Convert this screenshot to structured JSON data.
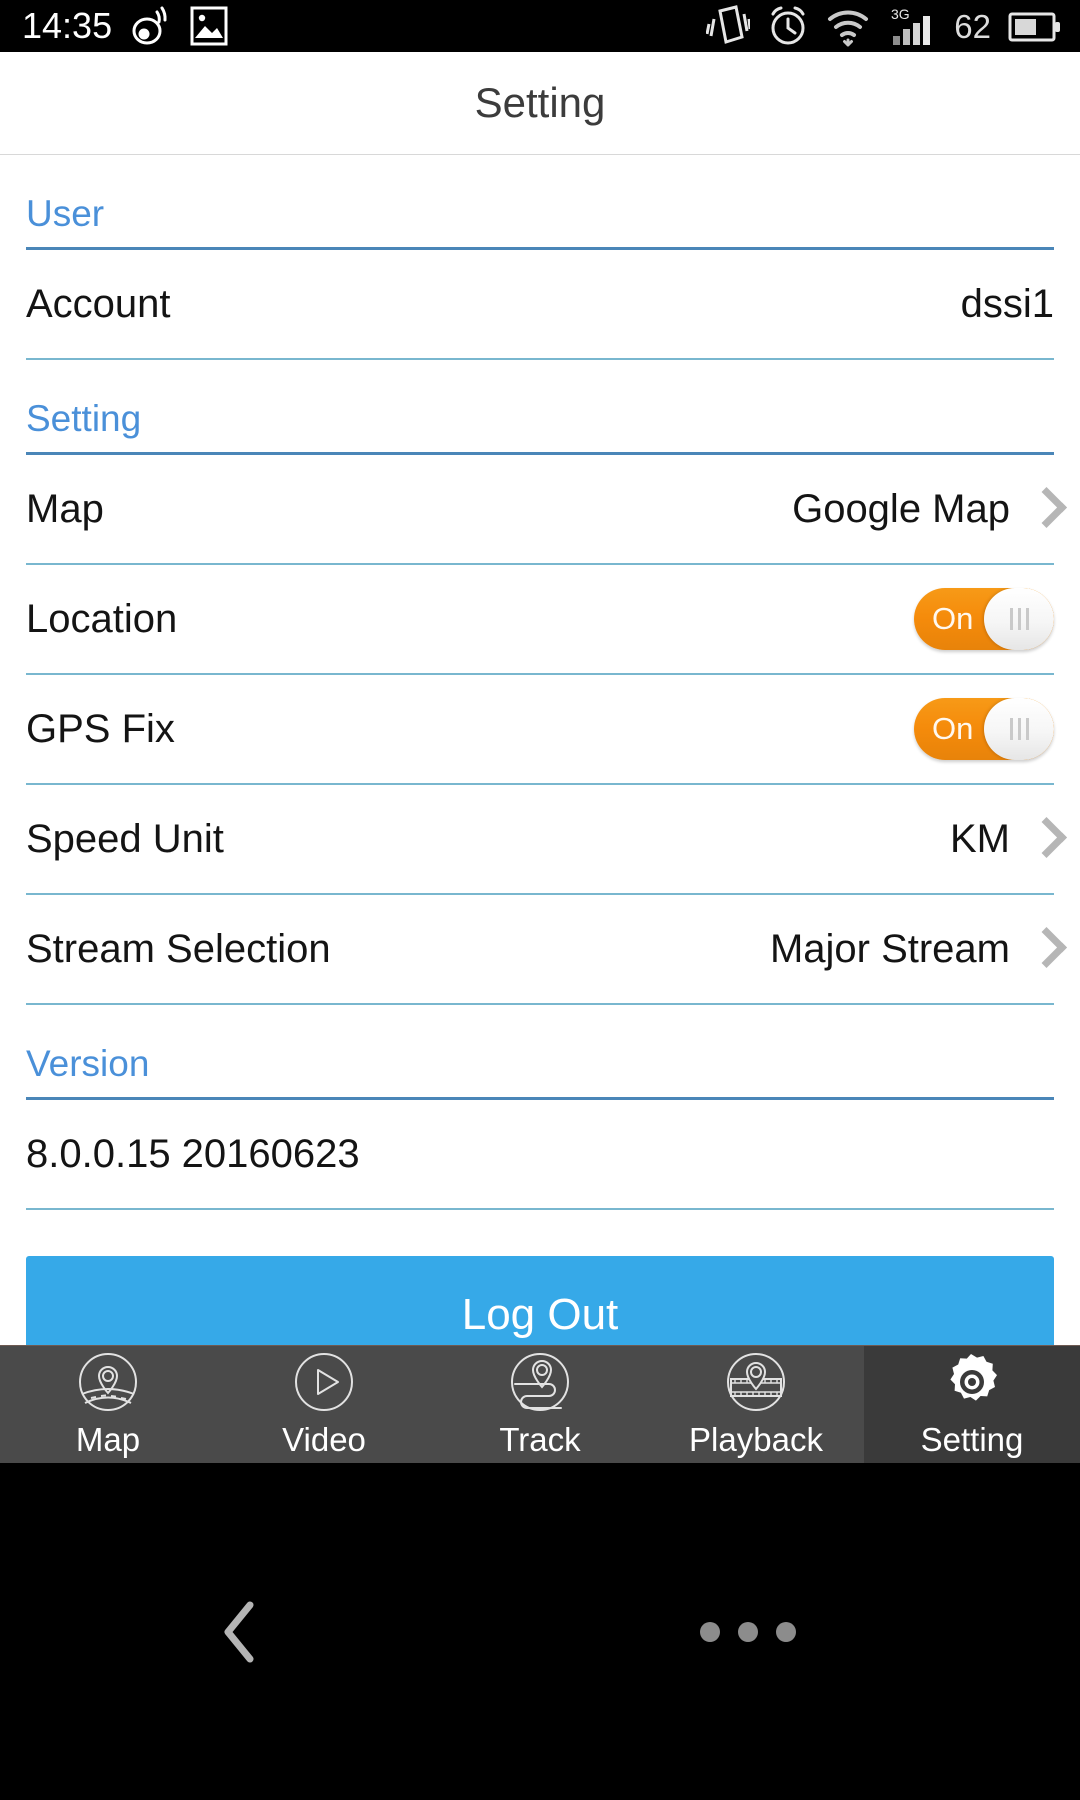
{
  "status_bar": {
    "time": "14:35",
    "battery_percent": "62",
    "icons": [
      "weibo-icon",
      "image-icon",
      "vibrate-icon",
      "alarm-icon",
      "wifi-icon",
      "signal-3g-icon",
      "battery-icon"
    ],
    "network_label": "3G"
  },
  "header": {
    "title": "Setting"
  },
  "sections": [
    {
      "id": "user",
      "header": "User",
      "rows": [
        {
          "label": "Account",
          "value": "dssi1",
          "control": "text"
        }
      ]
    },
    {
      "id": "setting",
      "header": "Setting",
      "rows": [
        {
          "label": "Map",
          "value": "Google Map",
          "control": "chevron"
        },
        {
          "label": "Location",
          "value": "On",
          "control": "toggle"
        },
        {
          "label": "GPS Fix",
          "value": "On",
          "control": "toggle"
        },
        {
          "label": "Speed Unit",
          "value": "KM",
          "control": "chevron"
        },
        {
          "label": "Stream Selection",
          "value": "Major Stream",
          "control": "chevron"
        }
      ]
    },
    {
      "id": "version",
      "header": "Version",
      "rows": [
        {
          "label": "8.0.0.15 20160623",
          "value": "",
          "control": "none"
        }
      ]
    }
  ],
  "logout": {
    "label": "Log Out"
  },
  "bottom_nav": {
    "items": [
      {
        "label": "Map",
        "icon": "map-pin-road-icon",
        "active": false
      },
      {
        "label": "Video",
        "icon": "play-circle-icon",
        "active": false
      },
      {
        "label": "Track",
        "icon": "track-route-icon",
        "active": false
      },
      {
        "label": "Playback",
        "icon": "playback-filmstrip-icon",
        "active": false
      },
      {
        "label": "Setting",
        "icon": "gear-icon",
        "active": true
      }
    ]
  },
  "system_nav": {
    "back": "back-chevron-icon",
    "menu": "overflow-dots-icon"
  },
  "colors": {
    "accent_blue": "#4a90d9",
    "divider_strong": "#4a86b8",
    "divider_light": "#79b7cf",
    "toggle_on": "#f58b0b",
    "logout_blue": "#36a9e8",
    "nav_bg": "#4a4a4a",
    "nav_active_bg": "#3a3a3a"
  }
}
